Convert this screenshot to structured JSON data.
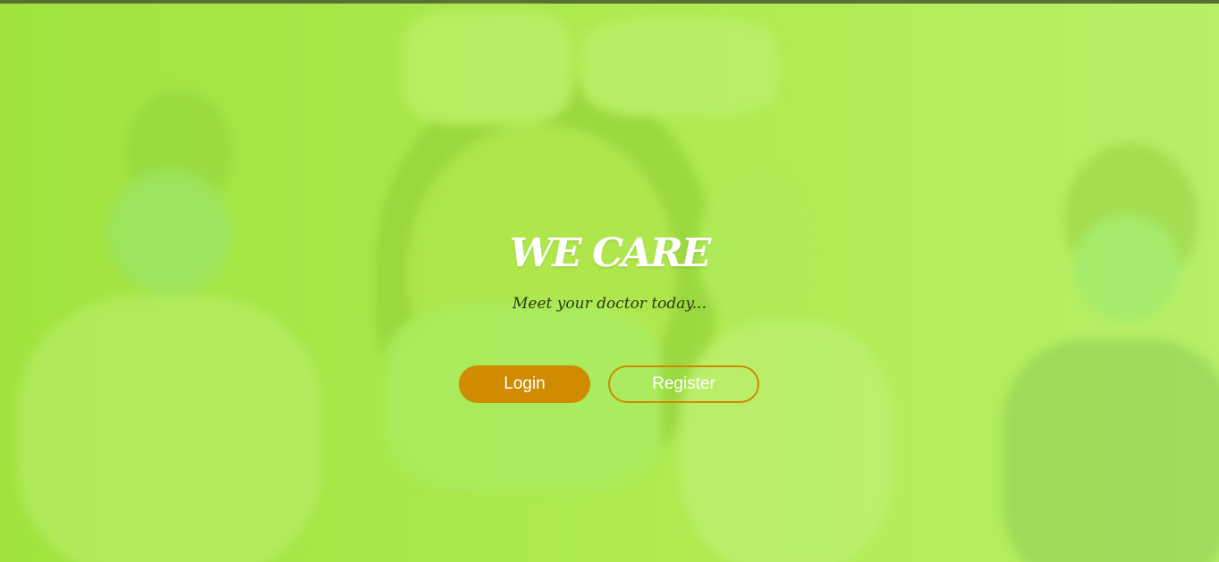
{
  "hero": {
    "title": "WE CARE",
    "tagline": "Meet your doctor today..."
  },
  "actions": {
    "login_label": "Login",
    "register_label": "Register"
  },
  "colors": {
    "accent": "#d08b00",
    "overlay": "#a6e64a",
    "top_bar": "#2d2d2d",
    "title_text": "#ffffff"
  }
}
